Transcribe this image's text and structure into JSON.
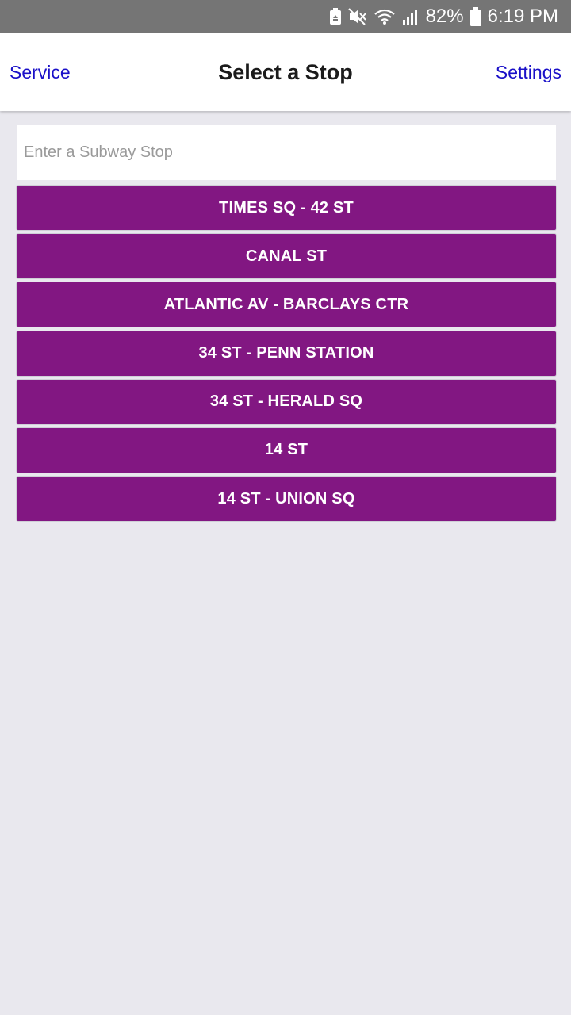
{
  "status_bar": {
    "battery_percent": "82%",
    "time": "6:19 PM",
    "icons": [
      "battery-saver-icon",
      "mute-icon",
      "wifi-icon",
      "signal-icon",
      "battery-icon"
    ]
  },
  "nav": {
    "left_label": "Service",
    "title": "Select a Stop",
    "right_label": "Settings",
    "link_color": "#1a10c8"
  },
  "search": {
    "placeholder": "Enter a Subway Stop",
    "value": ""
  },
  "stops": [
    {
      "label": "TIMES SQ - 42 ST"
    },
    {
      "label": "CANAL ST"
    },
    {
      "label": "ATLANTIC AV - BARCLAYS CTR"
    },
    {
      "label": "34 ST - PENN STATION"
    },
    {
      "label": "34 ST - HERALD SQ"
    },
    {
      "label": "14 ST"
    },
    {
      "label": "14 ST - UNION SQ"
    }
  ],
  "colors": {
    "stop_button": "#821782",
    "background": "#e9e8ee",
    "status_bar": "#757575"
  }
}
